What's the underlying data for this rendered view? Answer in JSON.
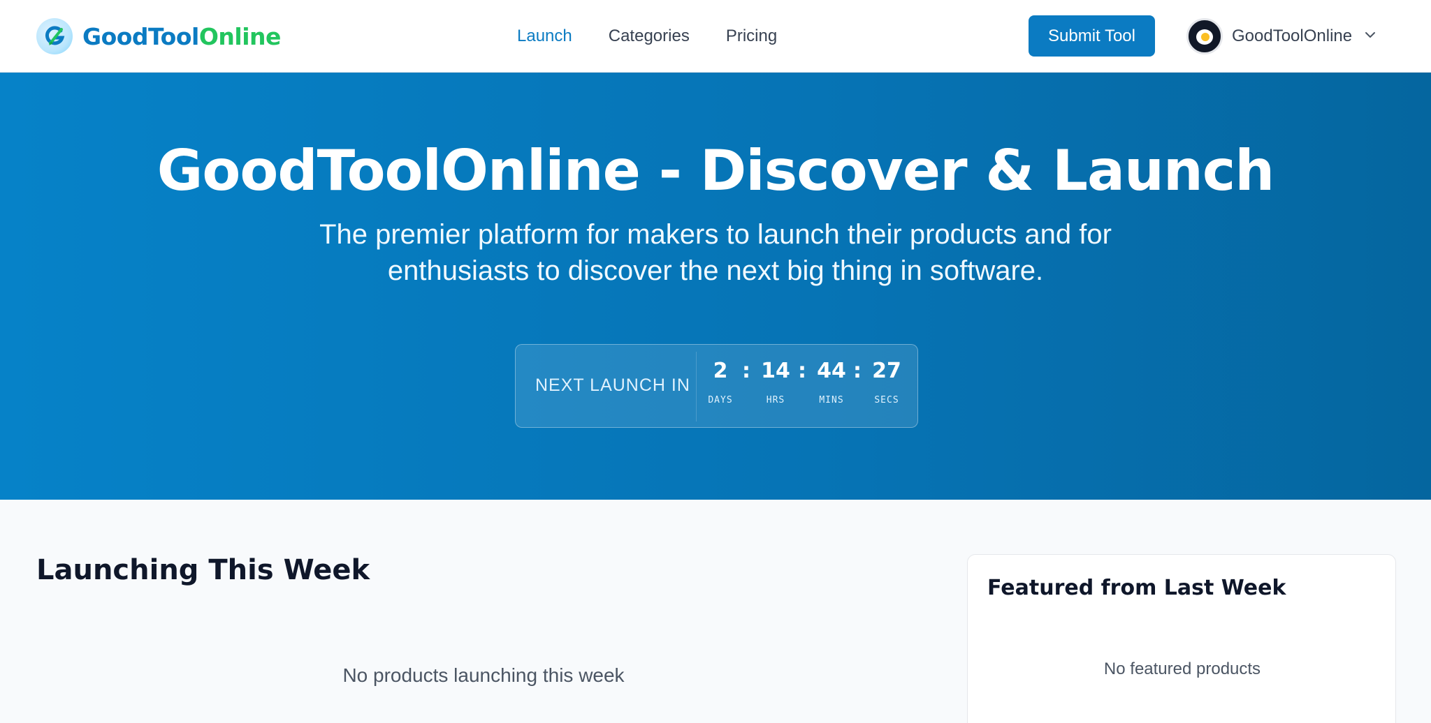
{
  "header": {
    "logo": {
      "part1": "GoodTool",
      "part2": "Online"
    },
    "nav": [
      {
        "label": "Launch",
        "active": true
      },
      {
        "label": "Categories",
        "active": false
      },
      {
        "label": "Pricing",
        "active": false
      }
    ],
    "submit_label": "Submit Tool",
    "user_name": "GoodToolOnline"
  },
  "hero": {
    "title": "GoodToolOnline - Discover & Launch",
    "subtitle": "The premier platform for makers to launch their products and for enthusiasts to discover the next big thing in software.",
    "countdown": {
      "label": "NEXT LAUNCH IN",
      "days": {
        "value": "2",
        "caption": "DAYS"
      },
      "hrs": {
        "value": "14",
        "caption": "HRS"
      },
      "mins": {
        "value": "44",
        "caption": "MINS"
      },
      "secs": {
        "value": "27",
        "caption": "SECS"
      },
      "separator": ":"
    }
  },
  "main": {
    "title": "Launching This Week",
    "empty_text": "No products launching this week"
  },
  "featured": {
    "title": "Featured from Last Week",
    "empty_text": "No featured products"
  },
  "colors": {
    "brand_blue": "#0b7bc2",
    "brand_green": "#22c55e",
    "hero_gradient_start": "#0682c8",
    "hero_gradient_end": "#05669f"
  },
  "icons": [
    "logo-icon",
    "avatar-icon",
    "chevron-down-icon"
  ]
}
